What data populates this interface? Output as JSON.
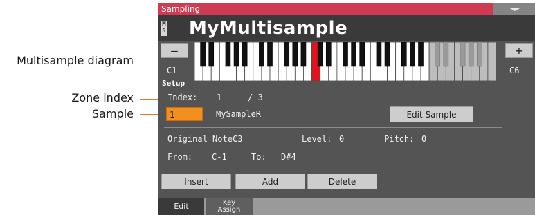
{
  "callouts": {
    "multisample_diagram": "Multisample diagram",
    "zone_index": "Zone index",
    "sample": "Sample"
  },
  "window": {
    "title": "Sampling"
  },
  "header": {
    "badge": "MS",
    "title": "MyMultisample"
  },
  "keyboard": {
    "minus_label": "–",
    "plus_label": "+",
    "low_key": "C1",
    "high_key": "C6",
    "highlight_color": "#e0141f",
    "selected_key": "C3"
  },
  "setup": {
    "section_label": "Setup",
    "index_label": "Index:",
    "index_value": "1",
    "index_total": "/ 3",
    "sample_number": "1",
    "sample_name": "MySampleR",
    "edit_sample_label": "Edit Sample",
    "original_note_label": "Original Note:",
    "original_note_value": "C3",
    "level_label": "Level:",
    "level_value": "0",
    "pitch_label": "Pitch:",
    "pitch_value": "0",
    "from_label": "From:",
    "from_value": "C-1",
    "to_label": "To:",
    "to_value": "D#4"
  },
  "actions": {
    "insert": "Insert",
    "add": "Add",
    "delete": "Delete"
  },
  "tabs": {
    "edit": "Edit",
    "key_assign_1": "Key",
    "key_assign_2": "Assign"
  },
  "colors": {
    "title_bar": "#cf3b52",
    "selected_field": "#f28f1f",
    "callout_line": "#e07a2e"
  }
}
